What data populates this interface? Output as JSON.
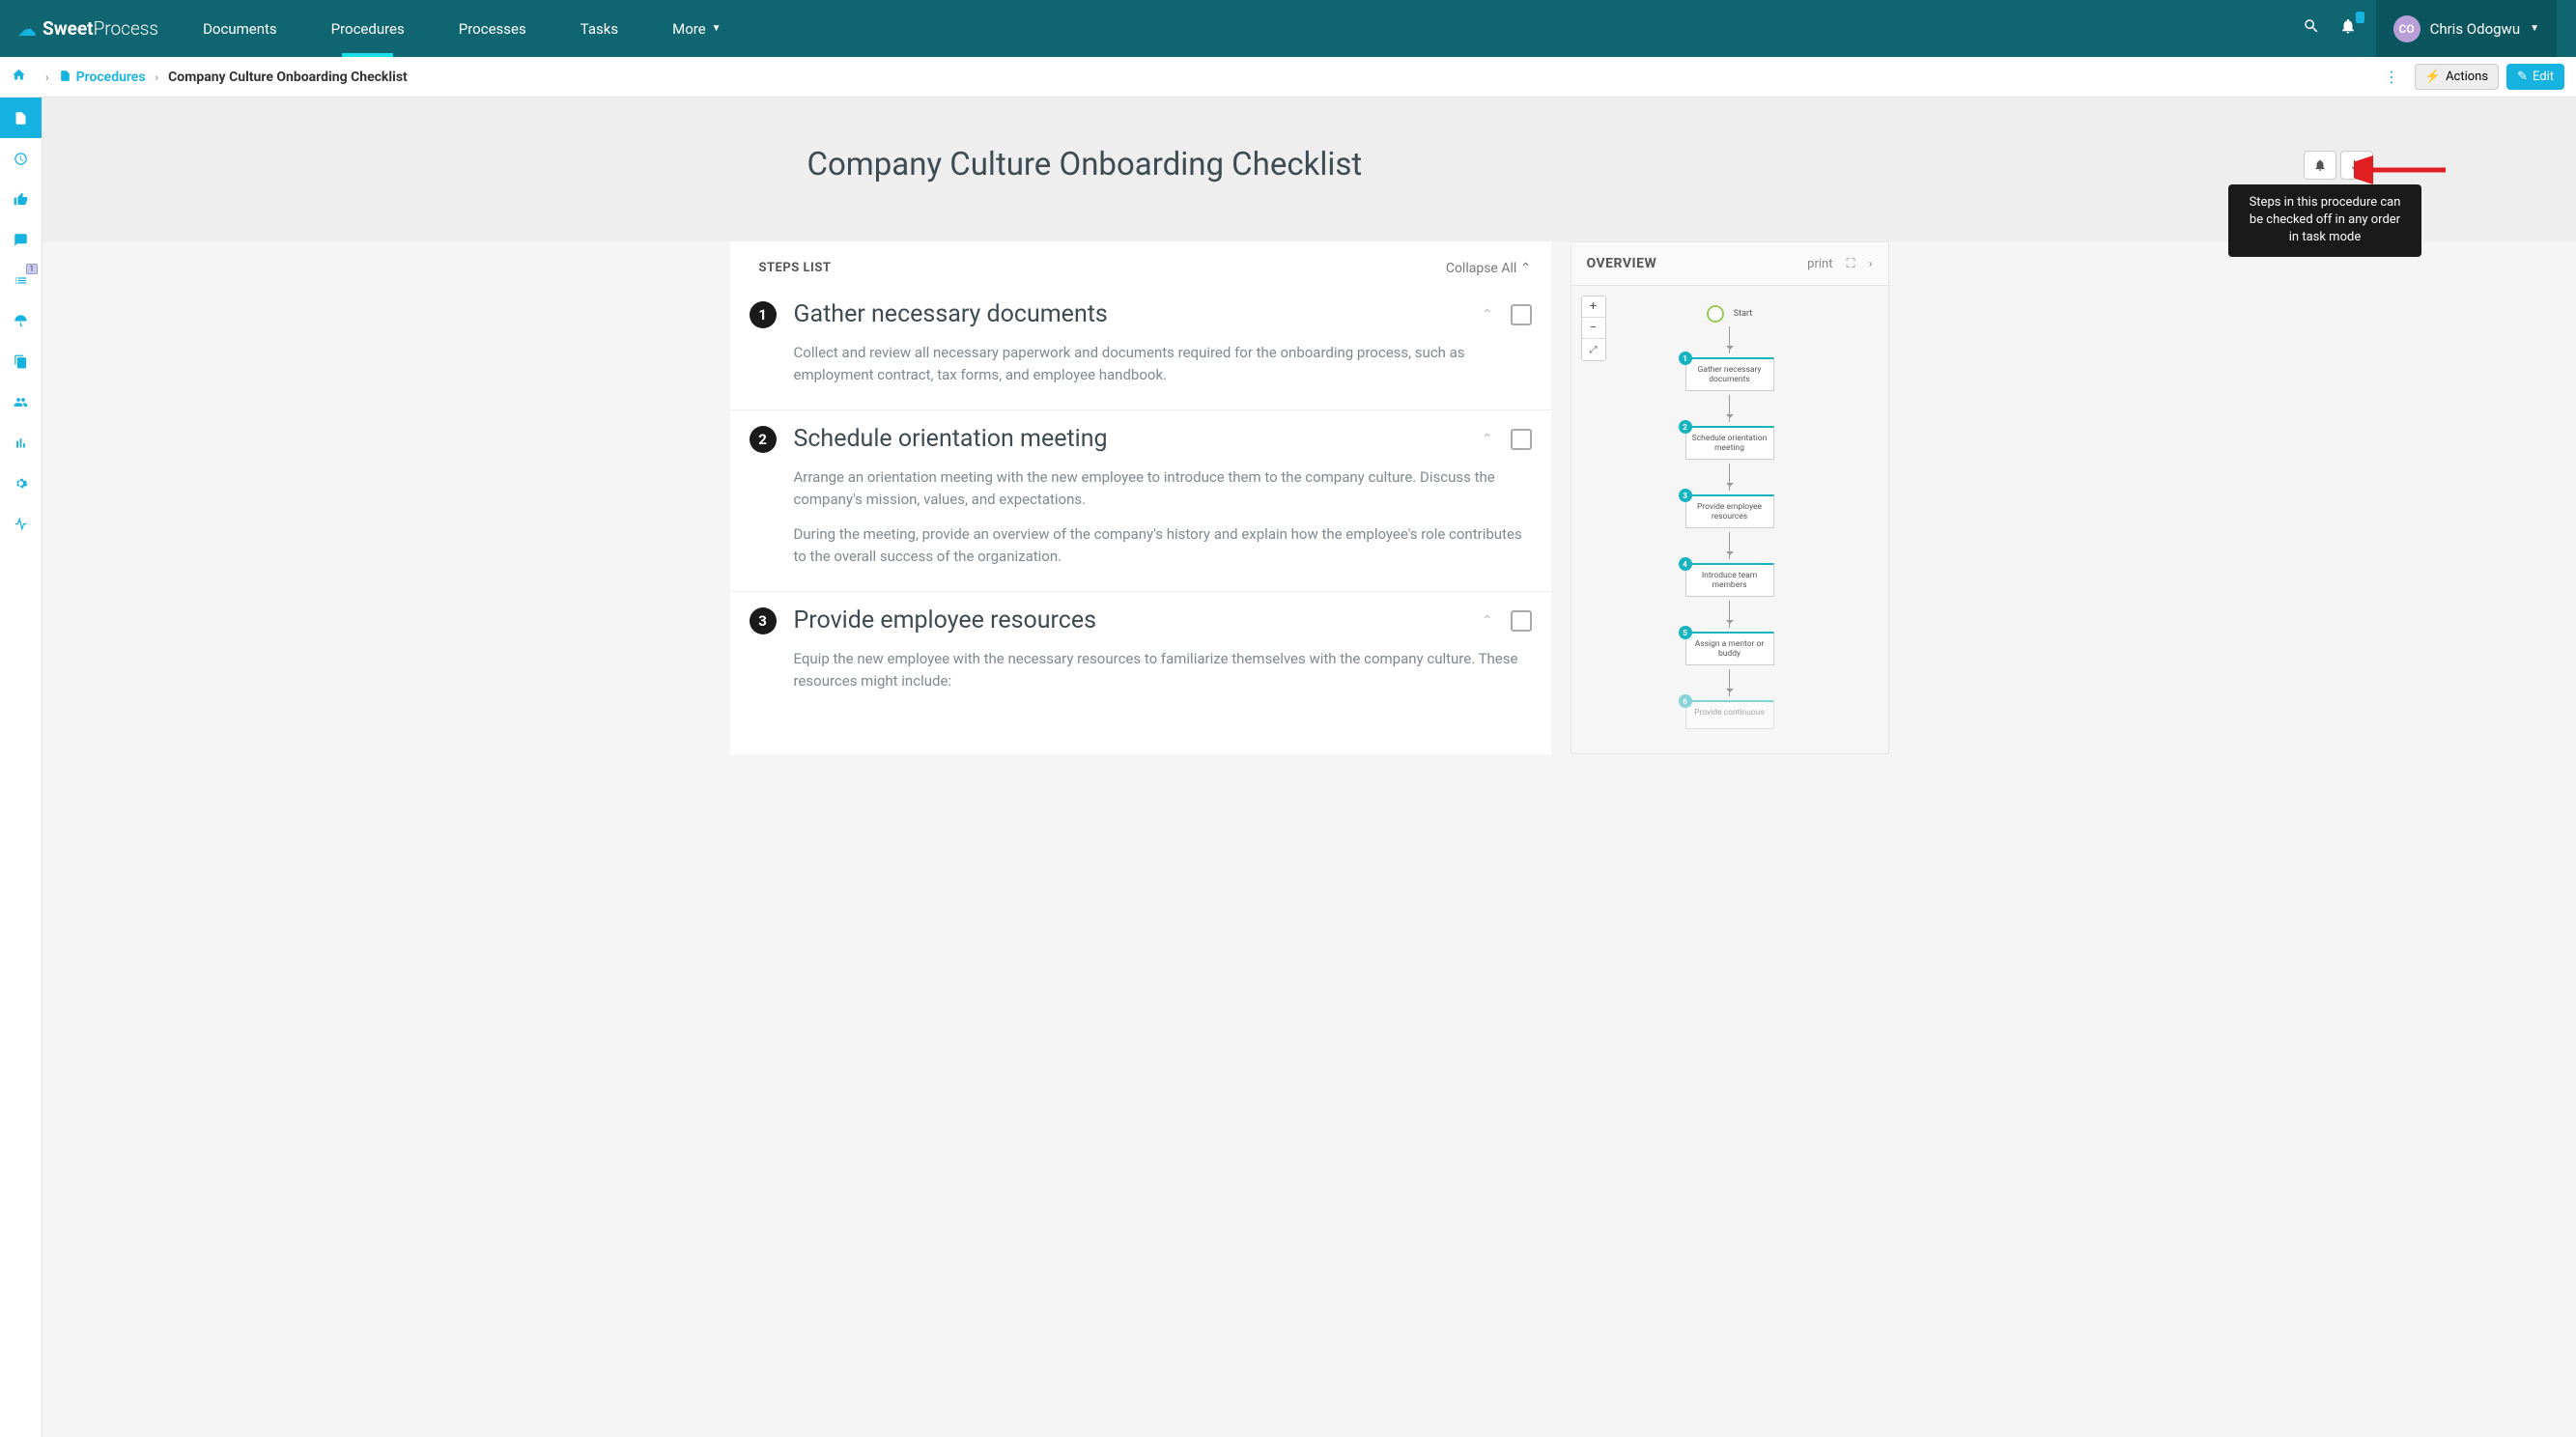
{
  "brand": {
    "name1": "Sweet",
    "name2": "Process"
  },
  "nav": {
    "items": [
      "Documents",
      "Procedures",
      "Processes",
      "Tasks",
      "More"
    ],
    "active": 1
  },
  "user": {
    "initials": "CO",
    "name": "Chris Odogwu"
  },
  "breadcrumb": {
    "link": "Procedures",
    "current": "Company Culture Onboarding Checklist"
  },
  "buttons": {
    "actions": "Actions",
    "edit": "Edit"
  },
  "page_title": "Company Culture Onboarding Checklist",
  "tooltip": "Steps in this procedure can be checked off in any order in task mode",
  "steps_header": {
    "label": "STEPS LIST",
    "collapse": "Collapse All"
  },
  "steps": [
    {
      "n": "1",
      "title": "Gather necessary documents",
      "body": [
        "Collect and review all necessary paperwork and documents required for the onboarding process, such as employment contract, tax forms, and employee handbook."
      ]
    },
    {
      "n": "2",
      "title": "Schedule orientation meeting",
      "body": [
        "Arrange an orientation meeting with the new employee to introduce them to the company culture. Discuss the company's mission, values, and expectations.",
        "During the meeting, provide an overview of the company's history and explain how the employee's role contributes to the overall success of the organization."
      ]
    },
    {
      "n": "3",
      "title": "Provide employee resources",
      "body": [
        "Equip the new employee with the necessary resources to familiarize themselves with the company culture. These resources might include:"
      ]
    }
  ],
  "overview": {
    "title": "OVERVIEW",
    "print": "print",
    "start": "Start",
    "nodes": [
      {
        "n": "1",
        "label": "Gather necessary documents"
      },
      {
        "n": "2",
        "label": "Schedule orientation meeting"
      },
      {
        "n": "3",
        "label": "Provide employee resources"
      },
      {
        "n": "4",
        "label": "Introduce team members"
      },
      {
        "n": "5",
        "label": "Assign a mentor or buddy"
      },
      {
        "n": "6",
        "label": "Provide continuous"
      }
    ]
  },
  "sidebar_badge": "1"
}
